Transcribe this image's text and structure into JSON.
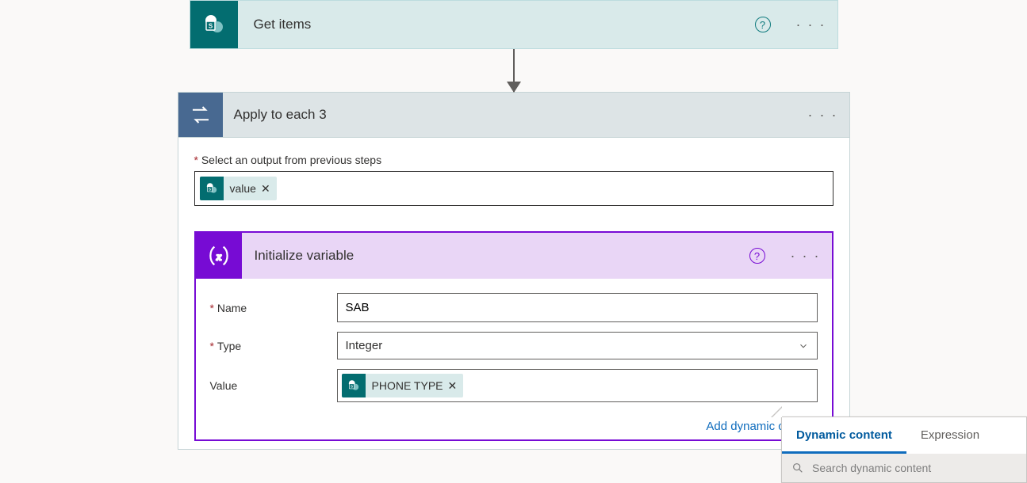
{
  "get_items": {
    "title": "Get items"
  },
  "apply_each": {
    "title": "Apply to each 3",
    "select_label": "Select an output from previous steps",
    "token_value": "value"
  },
  "init_var": {
    "title": "Initialize variable",
    "labels": {
      "name": "Name",
      "type": "Type",
      "value": "Value"
    },
    "name_value": "SAB",
    "type_value": "Integer",
    "value_token": "PHONE TYPE",
    "add_dc": "Add dynamic content"
  },
  "dc_panel": {
    "tab_dc": "Dynamic content",
    "tab_expr": "Expression",
    "search_placeholder": "Search dynamic content"
  }
}
